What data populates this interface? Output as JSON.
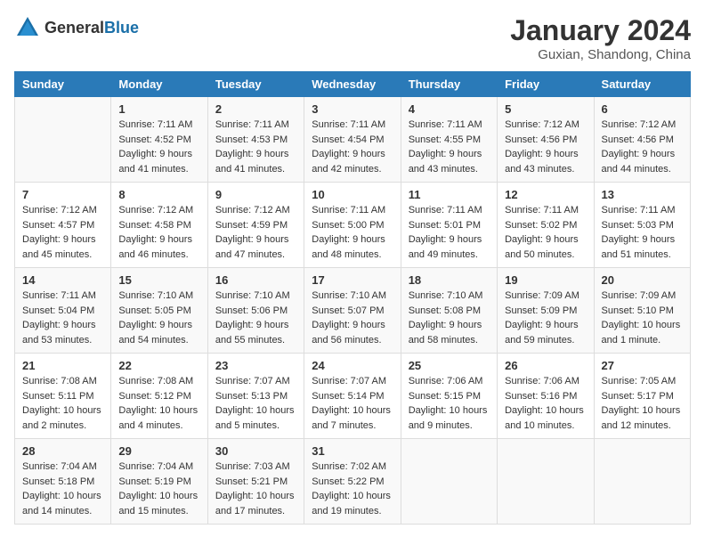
{
  "header": {
    "logo": {
      "general": "General",
      "blue": "Blue"
    },
    "title": "January 2024",
    "subtitle": "Guxian, Shandong, China"
  },
  "days_of_week": [
    "Sunday",
    "Monday",
    "Tuesday",
    "Wednesday",
    "Thursday",
    "Friday",
    "Saturday"
  ],
  "weeks": [
    [
      {
        "day": "",
        "sunrise": "",
        "sunset": "",
        "daylight": ""
      },
      {
        "day": "1",
        "sunrise": "Sunrise: 7:11 AM",
        "sunset": "Sunset: 4:52 PM",
        "daylight": "Daylight: 9 hours and 41 minutes."
      },
      {
        "day": "2",
        "sunrise": "Sunrise: 7:11 AM",
        "sunset": "Sunset: 4:53 PM",
        "daylight": "Daylight: 9 hours and 41 minutes."
      },
      {
        "day": "3",
        "sunrise": "Sunrise: 7:11 AM",
        "sunset": "Sunset: 4:54 PM",
        "daylight": "Daylight: 9 hours and 42 minutes."
      },
      {
        "day": "4",
        "sunrise": "Sunrise: 7:11 AM",
        "sunset": "Sunset: 4:55 PM",
        "daylight": "Daylight: 9 hours and 43 minutes."
      },
      {
        "day": "5",
        "sunrise": "Sunrise: 7:12 AM",
        "sunset": "Sunset: 4:56 PM",
        "daylight": "Daylight: 9 hours and 43 minutes."
      },
      {
        "day": "6",
        "sunrise": "Sunrise: 7:12 AM",
        "sunset": "Sunset: 4:56 PM",
        "daylight": "Daylight: 9 hours and 44 minutes."
      }
    ],
    [
      {
        "day": "7",
        "sunrise": "Sunrise: 7:12 AM",
        "sunset": "Sunset: 4:57 PM",
        "daylight": "Daylight: 9 hours and 45 minutes."
      },
      {
        "day": "8",
        "sunrise": "Sunrise: 7:12 AM",
        "sunset": "Sunset: 4:58 PM",
        "daylight": "Daylight: 9 hours and 46 minutes."
      },
      {
        "day": "9",
        "sunrise": "Sunrise: 7:12 AM",
        "sunset": "Sunset: 4:59 PM",
        "daylight": "Daylight: 9 hours and 47 minutes."
      },
      {
        "day": "10",
        "sunrise": "Sunrise: 7:11 AM",
        "sunset": "Sunset: 5:00 PM",
        "daylight": "Daylight: 9 hours and 48 minutes."
      },
      {
        "day": "11",
        "sunrise": "Sunrise: 7:11 AM",
        "sunset": "Sunset: 5:01 PM",
        "daylight": "Daylight: 9 hours and 49 minutes."
      },
      {
        "day": "12",
        "sunrise": "Sunrise: 7:11 AM",
        "sunset": "Sunset: 5:02 PM",
        "daylight": "Daylight: 9 hours and 50 minutes."
      },
      {
        "day": "13",
        "sunrise": "Sunrise: 7:11 AM",
        "sunset": "Sunset: 5:03 PM",
        "daylight": "Daylight: 9 hours and 51 minutes."
      }
    ],
    [
      {
        "day": "14",
        "sunrise": "Sunrise: 7:11 AM",
        "sunset": "Sunset: 5:04 PM",
        "daylight": "Daylight: 9 hours and 53 minutes."
      },
      {
        "day": "15",
        "sunrise": "Sunrise: 7:10 AM",
        "sunset": "Sunset: 5:05 PM",
        "daylight": "Daylight: 9 hours and 54 minutes."
      },
      {
        "day": "16",
        "sunrise": "Sunrise: 7:10 AM",
        "sunset": "Sunset: 5:06 PM",
        "daylight": "Daylight: 9 hours and 55 minutes."
      },
      {
        "day": "17",
        "sunrise": "Sunrise: 7:10 AM",
        "sunset": "Sunset: 5:07 PM",
        "daylight": "Daylight: 9 hours and 56 minutes."
      },
      {
        "day": "18",
        "sunrise": "Sunrise: 7:10 AM",
        "sunset": "Sunset: 5:08 PM",
        "daylight": "Daylight: 9 hours and 58 minutes."
      },
      {
        "day": "19",
        "sunrise": "Sunrise: 7:09 AM",
        "sunset": "Sunset: 5:09 PM",
        "daylight": "Daylight: 9 hours and 59 minutes."
      },
      {
        "day": "20",
        "sunrise": "Sunrise: 7:09 AM",
        "sunset": "Sunset: 5:10 PM",
        "daylight": "Daylight: 10 hours and 1 minute."
      }
    ],
    [
      {
        "day": "21",
        "sunrise": "Sunrise: 7:08 AM",
        "sunset": "Sunset: 5:11 PM",
        "daylight": "Daylight: 10 hours and 2 minutes."
      },
      {
        "day": "22",
        "sunrise": "Sunrise: 7:08 AM",
        "sunset": "Sunset: 5:12 PM",
        "daylight": "Daylight: 10 hours and 4 minutes."
      },
      {
        "day": "23",
        "sunrise": "Sunrise: 7:07 AM",
        "sunset": "Sunset: 5:13 PM",
        "daylight": "Daylight: 10 hours and 5 minutes."
      },
      {
        "day": "24",
        "sunrise": "Sunrise: 7:07 AM",
        "sunset": "Sunset: 5:14 PM",
        "daylight": "Daylight: 10 hours and 7 minutes."
      },
      {
        "day": "25",
        "sunrise": "Sunrise: 7:06 AM",
        "sunset": "Sunset: 5:15 PM",
        "daylight": "Daylight: 10 hours and 9 minutes."
      },
      {
        "day": "26",
        "sunrise": "Sunrise: 7:06 AM",
        "sunset": "Sunset: 5:16 PM",
        "daylight": "Daylight: 10 hours and 10 minutes."
      },
      {
        "day": "27",
        "sunrise": "Sunrise: 7:05 AM",
        "sunset": "Sunset: 5:17 PM",
        "daylight": "Daylight: 10 hours and 12 minutes."
      }
    ],
    [
      {
        "day": "28",
        "sunrise": "Sunrise: 7:04 AM",
        "sunset": "Sunset: 5:18 PM",
        "daylight": "Daylight: 10 hours and 14 minutes."
      },
      {
        "day": "29",
        "sunrise": "Sunrise: 7:04 AM",
        "sunset": "Sunset: 5:19 PM",
        "daylight": "Daylight: 10 hours and 15 minutes."
      },
      {
        "day": "30",
        "sunrise": "Sunrise: 7:03 AM",
        "sunset": "Sunset: 5:21 PM",
        "daylight": "Daylight: 10 hours and 17 minutes."
      },
      {
        "day": "31",
        "sunrise": "Sunrise: 7:02 AM",
        "sunset": "Sunset: 5:22 PM",
        "daylight": "Daylight: 10 hours and 19 minutes."
      },
      {
        "day": "",
        "sunrise": "",
        "sunset": "",
        "daylight": ""
      },
      {
        "day": "",
        "sunrise": "",
        "sunset": "",
        "daylight": ""
      },
      {
        "day": "",
        "sunrise": "",
        "sunset": "",
        "daylight": ""
      }
    ]
  ]
}
